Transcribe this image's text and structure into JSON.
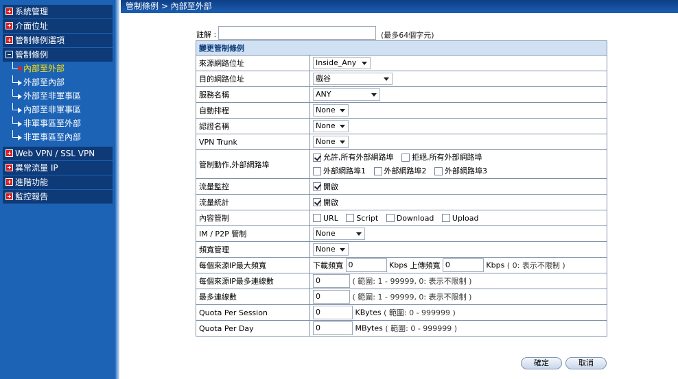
{
  "sidebar": {
    "top_items": [
      {
        "label": "系統管理"
      },
      {
        "label": "介面位址"
      },
      {
        "label": "管制條例選項"
      }
    ],
    "expanded": {
      "label": "管制條例"
    },
    "sub_items": [
      {
        "label": "內部至外部"
      },
      {
        "label": "外部至內部"
      },
      {
        "label": "外部至非軍事區"
      },
      {
        "label": "內部至非軍事區"
      },
      {
        "label": "非軍事區至外部"
      },
      {
        "label": "非軍事區至內部"
      }
    ],
    "bottom_items": [
      {
        "label": "Web VPN / SSL VPN"
      },
      {
        "label": "異常流量 IP"
      },
      {
        "label": "進階功能"
      },
      {
        "label": "監控報告"
      }
    ]
  },
  "breadcrumb": "管制條例 > 內部至外部",
  "note": {
    "label": "註解 :",
    "value": "",
    "hint": "(最多64個字元)"
  },
  "table": {
    "header": "變更管制條例",
    "source_address": {
      "label": "來源網路位址",
      "value": "Inside_Any"
    },
    "dest_address": {
      "label": "目的網路位址",
      "value": "戲谷"
    },
    "service": {
      "label": "服務名稱",
      "value": "ANY"
    },
    "schedule": {
      "label": "自動排程",
      "value": "None"
    },
    "auth": {
      "label": "認證名稱",
      "value": "None"
    },
    "vpn_trunk": {
      "label": "VPN Trunk",
      "value": "None"
    },
    "action": {
      "label": "管制動作,外部網路埠",
      "allow_all": "允許,所有外部網路埠",
      "deny_all": "拒絕,所有外部網路埠",
      "port1": "外部網路埠1",
      "port2": "外部網路埠2",
      "port3": "外部網路埠3"
    },
    "traffic_log": {
      "label": "流量監控",
      "option": "開啟"
    },
    "statistics": {
      "label": "流量統計",
      "option": "開啟"
    },
    "content_blocking": {
      "label": "內容管制",
      "url": "URL",
      "script": "Script",
      "download": "Download",
      "upload": "Upload"
    },
    "im_p2p": {
      "label": "IM / P2P 管制",
      "value": "None"
    },
    "qos": {
      "label": "頻寬管理",
      "value": "None"
    },
    "max_bandwidth": {
      "label": "每個來源IP最大頻寬",
      "down_label": "下載頻寬",
      "down_value": "0",
      "unit1": "Kbps",
      "up_label": "上傳頻寬",
      "up_value": "0",
      "unit2": "Kbps",
      "hint": "( 0: 表示不限制 )"
    },
    "max_conn_per_ip": {
      "label": "每個來源IP最多連線數",
      "value": "0",
      "hint": "( 範圍: 1 - 99999, 0: 表示不限制 )"
    },
    "max_conn": {
      "label": "最多連線數",
      "value": "0",
      "hint": "( 範圍: 1 - 99999, 0: 表示不限制 )"
    },
    "quota_session": {
      "label": "Quota Per Session",
      "value": "0",
      "unit": "KBytes",
      "hint": "( 範圍: 0 - 999999 )"
    },
    "quota_day": {
      "label": "Quota Per Day",
      "value": "0",
      "unit": "MBytes",
      "hint": "( 範圍: 0 - 999999 )"
    }
  },
  "buttons": {
    "ok": "確定",
    "cancel": "取消"
  }
}
